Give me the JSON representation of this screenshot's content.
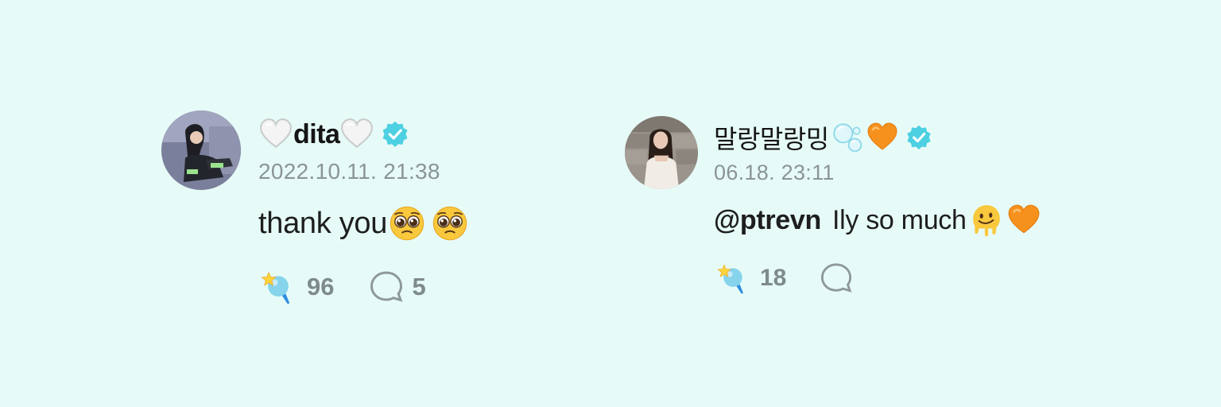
{
  "colors": {
    "background": "#e6fbf8",
    "verified": "#49cfe0",
    "meta_text": "#8b9496",
    "count_text": "#7f8a8d"
  },
  "posts": [
    {
      "name_prefix_icon": "white-heart-icon",
      "name": "dita",
      "name_suffix_icon": "white-heart-icon",
      "verified_icon": "verified-badge-icon",
      "timestamp": "2022.10.11. 21:38",
      "message": "thank you",
      "message_icons": [
        "pleading-face-icon",
        "pleading-face-icon"
      ],
      "like_icon": "star-microphone-icon",
      "like_count": "96",
      "comment_icon": "speech-bubble-icon",
      "comment_count": "5"
    },
    {
      "name": "말랑말랑밍",
      "name_suffix_icons": [
        "bubbles-icon",
        "orange-heart-icon"
      ],
      "verified_icon": "verified-badge-icon",
      "timestamp": "06.18. 23:11",
      "mention": "@ptrevn",
      "message": "Ily so much",
      "message_icons": [
        "melting-face-icon",
        "orange-heart-icon"
      ],
      "like_icon": "star-microphone-icon",
      "like_count": "18",
      "comment_icon": "speech-bubble-icon",
      "comment_count": ""
    }
  ]
}
